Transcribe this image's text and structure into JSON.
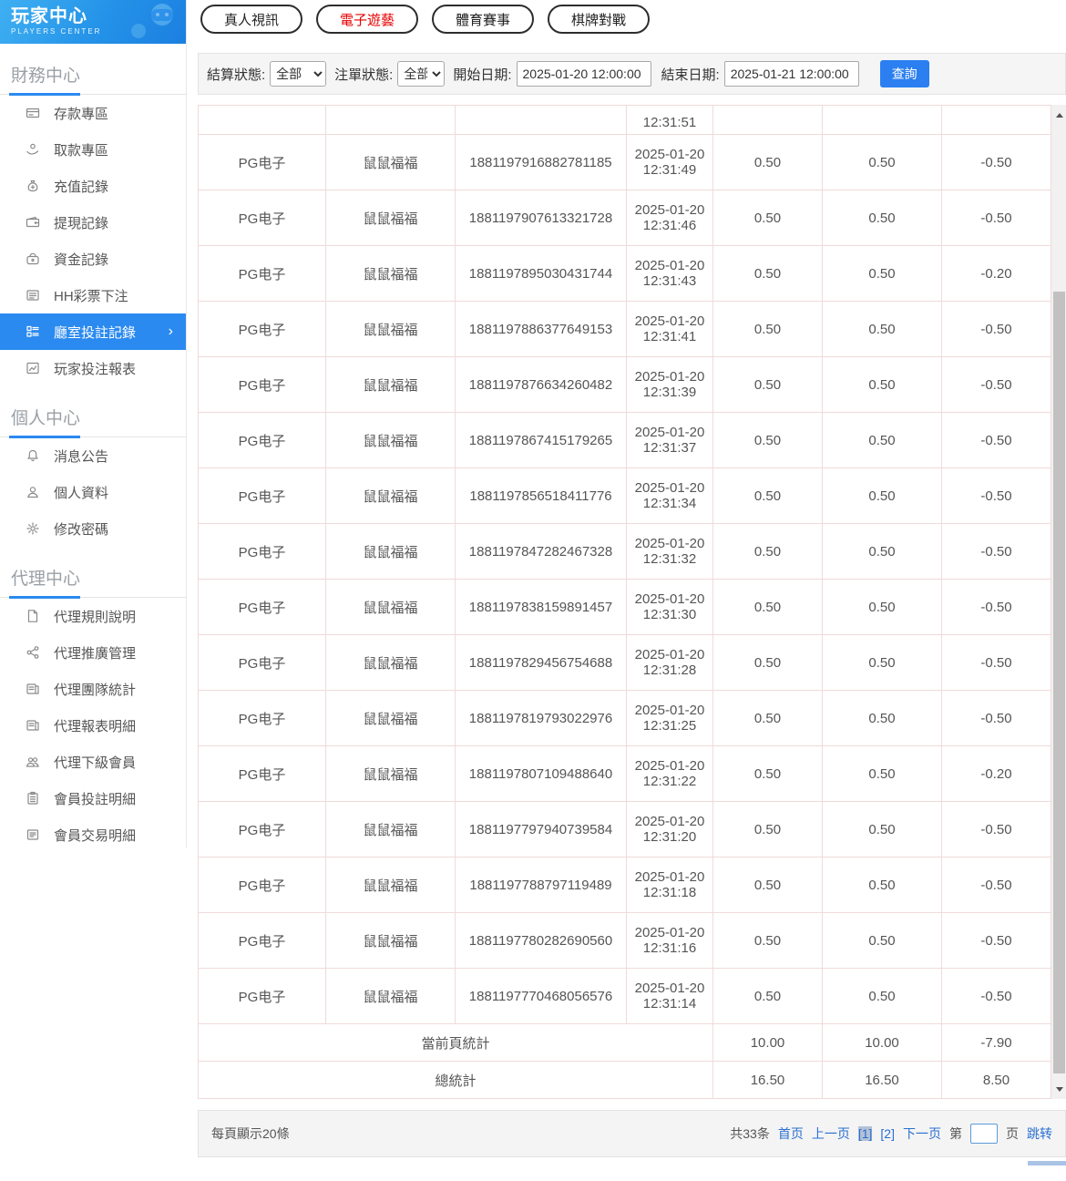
{
  "app": {
    "title": "玩家中心",
    "subtitle": "PLAYERS CENTER"
  },
  "sidebar": {
    "sections": [
      {
        "title": "財務中心",
        "items": [
          {
            "icon": "bank-card-icon",
            "label": "存款專區",
            "active": false
          },
          {
            "icon": "hand-coin-icon",
            "label": "取款專區",
            "active": false
          },
          {
            "icon": "money-bag-icon",
            "label": "充值記錄",
            "active": false
          },
          {
            "icon": "wallet-icon",
            "label": "提現記錄",
            "active": false
          },
          {
            "icon": "purse-icon",
            "label": "資金記錄",
            "active": false
          },
          {
            "icon": "lottery-list-icon",
            "label": "HH彩票下注",
            "active": false
          },
          {
            "icon": "bet-record-icon",
            "label": "廳室投註記錄",
            "active": true
          },
          {
            "icon": "report-chart-icon",
            "label": "玩家投注報表",
            "active": false
          }
        ]
      },
      {
        "title": "個人中心",
        "items": [
          {
            "icon": "bell-icon",
            "label": "消息公告",
            "active": false
          },
          {
            "icon": "user-icon",
            "label": "個人資料",
            "active": false
          },
          {
            "icon": "gear-icon",
            "label": "修改密碼",
            "active": false
          }
        ]
      },
      {
        "title": "代理中心",
        "items": [
          {
            "icon": "document-icon",
            "label": "代理規則說明",
            "active": false
          },
          {
            "icon": "share-icon",
            "label": "代理推廣管理",
            "active": false
          },
          {
            "icon": "team-stats-icon",
            "label": "代理團隊統計",
            "active": false
          },
          {
            "icon": "report-detail-icon",
            "label": "代理報表明細",
            "active": false
          },
          {
            "icon": "members-icon",
            "label": "代理下級會員",
            "active": false
          },
          {
            "icon": "bet-detail-icon",
            "label": "會員投註明細",
            "active": false
          },
          {
            "icon": "transaction-detail-icon",
            "label": "會員交易明細",
            "active": false
          }
        ]
      }
    ]
  },
  "tabs": [
    {
      "label": "真人視訊",
      "active": false
    },
    {
      "label": "電子遊藝",
      "active": true
    },
    {
      "label": "體育賽事",
      "active": false
    },
    {
      "label": "棋牌對戰",
      "active": false
    }
  ],
  "filters": {
    "settle_label": "結算狀態:",
    "settle_value": "全部",
    "order_label": "注單狀態:",
    "order_value": "全部",
    "start_label": "開始日期:",
    "start_value": "2025-01-20 12:00:00",
    "end_label": "結束日期:",
    "end_value": "2025-01-21 12:00:00",
    "query_label": "查詢"
  },
  "table": {
    "partial_row_time": "12:31:51",
    "rows": [
      {
        "platform": "PG电子",
        "game": "鼠鼠福福",
        "order": "1881197916882781185",
        "date": "2025-01-20",
        "time": "12:31:49",
        "bet": "0.50",
        "valid": "0.50",
        "win": "-0.50"
      },
      {
        "platform": "PG电子",
        "game": "鼠鼠福福",
        "order": "1881197907613321728",
        "date": "2025-01-20",
        "time": "12:31:46",
        "bet": "0.50",
        "valid": "0.50",
        "win": "-0.50"
      },
      {
        "platform": "PG电子",
        "game": "鼠鼠福福",
        "order": "1881197895030431744",
        "date": "2025-01-20",
        "time": "12:31:43",
        "bet": "0.50",
        "valid": "0.50",
        "win": "-0.20"
      },
      {
        "platform": "PG电子",
        "game": "鼠鼠福福",
        "order": "1881197886377649153",
        "date": "2025-01-20",
        "time": "12:31:41",
        "bet": "0.50",
        "valid": "0.50",
        "win": "-0.50"
      },
      {
        "platform": "PG电子",
        "game": "鼠鼠福福",
        "order": "1881197876634260482",
        "date": "2025-01-20",
        "time": "12:31:39",
        "bet": "0.50",
        "valid": "0.50",
        "win": "-0.50"
      },
      {
        "platform": "PG电子",
        "game": "鼠鼠福福",
        "order": "1881197867415179265",
        "date": "2025-01-20",
        "time": "12:31:37",
        "bet": "0.50",
        "valid": "0.50",
        "win": "-0.50"
      },
      {
        "platform": "PG电子",
        "game": "鼠鼠福福",
        "order": "1881197856518411776",
        "date": "2025-01-20",
        "time": "12:31:34",
        "bet": "0.50",
        "valid": "0.50",
        "win": "-0.50"
      },
      {
        "platform": "PG电子",
        "game": "鼠鼠福福",
        "order": "1881197847282467328",
        "date": "2025-01-20",
        "time": "12:31:32",
        "bet": "0.50",
        "valid": "0.50",
        "win": "-0.50"
      },
      {
        "platform": "PG电子",
        "game": "鼠鼠福福",
        "order": "1881197838159891457",
        "date": "2025-01-20",
        "time": "12:31:30",
        "bet": "0.50",
        "valid": "0.50",
        "win": "-0.50"
      },
      {
        "platform": "PG电子",
        "game": "鼠鼠福福",
        "order": "1881197829456754688",
        "date": "2025-01-20",
        "time": "12:31:28",
        "bet": "0.50",
        "valid": "0.50",
        "win": "-0.50"
      },
      {
        "platform": "PG电子",
        "game": "鼠鼠福福",
        "order": "1881197819793022976",
        "date": "2025-01-20",
        "time": "12:31:25",
        "bet": "0.50",
        "valid": "0.50",
        "win": "-0.50"
      },
      {
        "platform": "PG电子",
        "game": "鼠鼠福福",
        "order": "1881197807109488640",
        "date": "2025-01-20",
        "time": "12:31:22",
        "bet": "0.50",
        "valid": "0.50",
        "win": "-0.20"
      },
      {
        "platform": "PG电子",
        "game": "鼠鼠福福",
        "order": "1881197797940739584",
        "date": "2025-01-20",
        "time": "12:31:20",
        "bet": "0.50",
        "valid": "0.50",
        "win": "-0.50"
      },
      {
        "platform": "PG电子",
        "game": "鼠鼠福福",
        "order": "1881197788797119489",
        "date": "2025-01-20",
        "time": "12:31:18",
        "bet": "0.50",
        "valid": "0.50",
        "win": "-0.50"
      },
      {
        "platform": "PG电子",
        "game": "鼠鼠福福",
        "order": "1881197780282690560",
        "date": "2025-01-20",
        "time": "12:31:16",
        "bet": "0.50",
        "valid": "0.50",
        "win": "-0.50"
      },
      {
        "platform": "PG电子",
        "game": "鼠鼠福福",
        "order": "1881197770468056576",
        "date": "2025-01-20",
        "time": "12:31:14",
        "bet": "0.50",
        "valid": "0.50",
        "win": "-0.50"
      }
    ],
    "summary": [
      {
        "label": "當前頁統計",
        "bet": "10.00",
        "valid": "10.00",
        "win": "-7.90"
      },
      {
        "label": "總統計",
        "bet": "16.50",
        "valid": "16.50",
        "win": "8.50"
      }
    ]
  },
  "pagination": {
    "per_page": "每頁顯示20條",
    "total": "共33条",
    "first": "首页",
    "prev": "上一页",
    "pages": [
      {
        "label": "[1]",
        "current": true
      },
      {
        "label": "[2]",
        "current": false
      }
    ],
    "next": "下一页",
    "jump_before": "第",
    "jump_after": "页",
    "jump_action": "跳转",
    "jump_value": ""
  },
  "colors": {
    "accent_blue": "#2a8af0",
    "tab_active_red": "#e60000",
    "link_blue": "#2a6fd0",
    "table_border": "#f0dada",
    "query_button_blue": "#2b7ff0"
  }
}
